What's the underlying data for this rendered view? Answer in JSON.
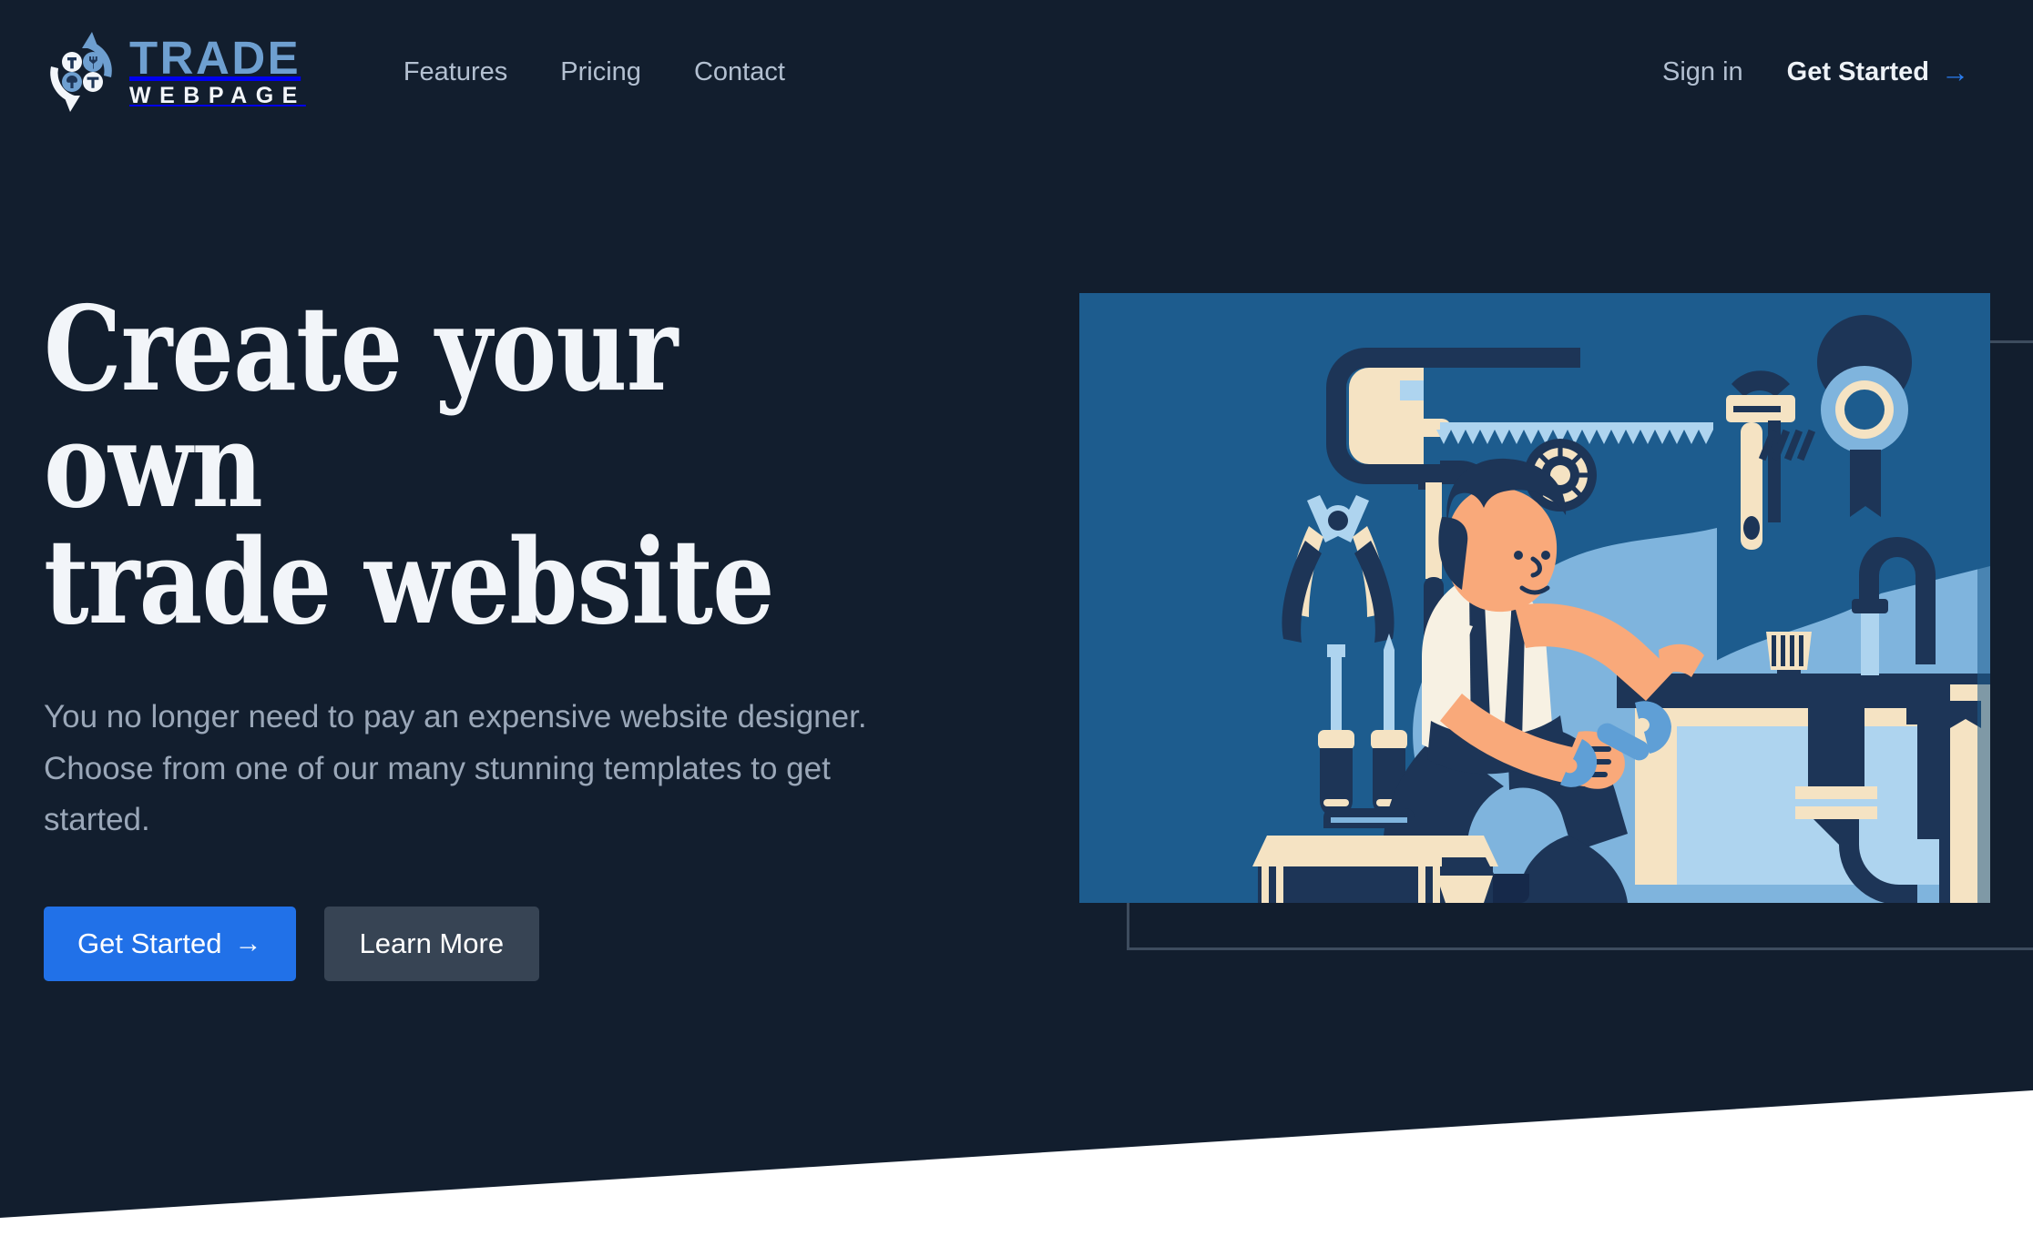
{
  "brand": {
    "name_primary": "TRADE",
    "name_secondary": "WEBPAGE",
    "logo_icon": "circular-arrows-tools-icon",
    "color_primary": "#6e9fd0",
    "color_secondary": "#f3f6fa"
  },
  "nav": {
    "links": [
      {
        "label": "Features"
      },
      {
        "label": "Pricing"
      },
      {
        "label": "Contact"
      }
    ],
    "signin_label": "Sign in",
    "cta_label": "Get Started",
    "cta_arrow": "→",
    "cta_arrow_color": "#2b7ef0"
  },
  "hero": {
    "headline": "Create your own\ntrade website",
    "subcopy": "You no longer need to pay an expensive website designer. Choose from one of our many stunning templates to get started.",
    "primary_button": {
      "label": "Get Started",
      "arrow": "→",
      "color": "#2171e8"
    },
    "secondary_button": {
      "label": "Learn More",
      "color": "#374454"
    },
    "illustration": {
      "name": "plumber-under-sink-illustration",
      "alt": "Tradesperson kneeling with a wrench repairing pipes under a sink, surrounded by tools",
      "background_color": "#1d5c8e",
      "accent_color": "#7fb4dd",
      "cream_color": "#f5e3c3",
      "navy_color": "#1d3557",
      "skin_color": "#f9a97a"
    }
  },
  "theme": {
    "background_dark": "#121e2e",
    "background_light": "#ffffff",
    "text_muted": "#9aa7b8",
    "text_bright": "#f2f5f9",
    "frame_border": "#3d4c5e"
  }
}
